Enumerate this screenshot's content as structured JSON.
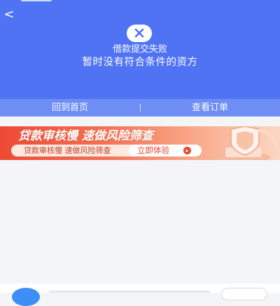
{
  "colors": {
    "header_bg": "#4f73f3",
    "actions_bg": "#6e8df5",
    "page_bg": "#f4f5f7",
    "banner_accent": "#e34a2f"
  },
  "header": {
    "back_glyph": "<",
    "status_icon": "close-icon",
    "title": "借款提交失败",
    "subtitle": "暂时没有符合条件的资方"
  },
  "actions": {
    "home_label": "回到首页",
    "orders_label": "查看订单"
  },
  "banner": {
    "title": "贷款审核慢 速做风险筛查",
    "subtitle": "贷款审核慢 速做风险筛查",
    "cta_label": "立即体验",
    "cta_icon": "chevron-right-icon",
    "art_icon": "shield-icon"
  }
}
